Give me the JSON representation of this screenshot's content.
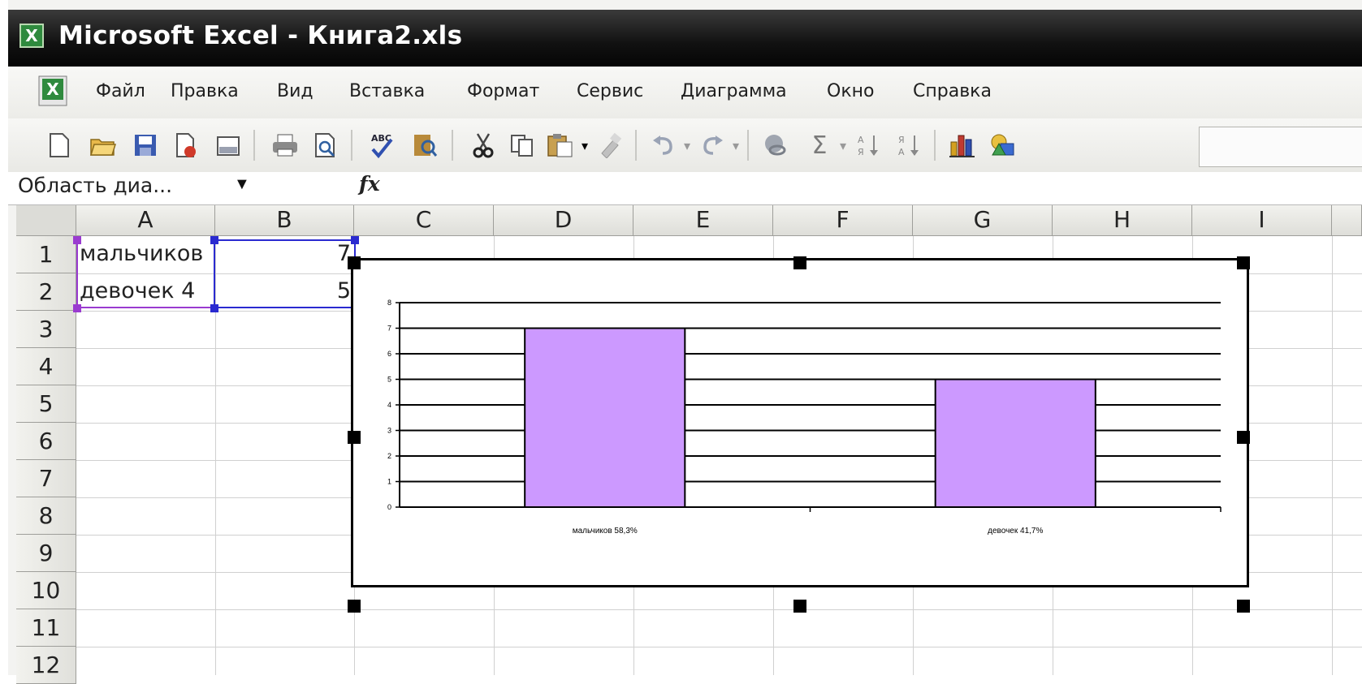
{
  "window": {
    "title": "Microsoft Excel - Книга2.xls"
  },
  "menu": {
    "items": [
      "Файл",
      "Правка",
      "Вид",
      "Вставка",
      "Формат",
      "Сервис",
      "Диаграмма",
      "Окно",
      "Справка"
    ]
  },
  "toolbar": {
    "icons": [
      "new-icon",
      "open-icon",
      "save-icon",
      "permission-icon",
      "email-icon",
      "print-icon",
      "print-preview-icon",
      "spelling-icon",
      "research-icon",
      "cut-icon",
      "copy-icon",
      "paste-icon",
      "paste-dropdown-icon",
      "format-painter-icon",
      "undo-icon",
      "undo-dropdown-icon",
      "redo-icon",
      "redo-dropdown-icon",
      "hyperlink-icon",
      "autosum-icon",
      "autosum-dropdown-icon",
      "sort-ascending-icon",
      "sort-descending-icon",
      "chart-wizard-icon",
      "drawing-icon"
    ],
    "sum_symbol": "Σ"
  },
  "formula_bar": {
    "name_box": "Область диа...",
    "fx": "fx",
    "formula": ""
  },
  "sheet": {
    "columns": [
      "A",
      "B",
      "C",
      "D",
      "E",
      "F",
      "G",
      "H",
      "I"
    ],
    "rows": [
      "1",
      "2",
      "3",
      "4",
      "5",
      "6",
      "7",
      "8",
      "9",
      "10",
      "11",
      "12"
    ],
    "cells": {
      "A1": "мальчиков",
      "B1": "7",
      "A2": "девочек 4",
      "B2": "5"
    }
  },
  "colors": {
    "bar_fill": "#cc99ff",
    "title_bar": "#111111"
  },
  "chart_data": {
    "type": "bar",
    "categories": [
      "мальчиков 58,3%",
      "девочек 41,7%"
    ],
    "series": [
      {
        "values": [
          7,
          5
        ]
      }
    ],
    "ylim": [
      0,
      8
    ],
    "yticks": [
      "0",
      "1",
      "2",
      "3",
      "4",
      "5",
      "6",
      "7",
      "8"
    ],
    "title": "",
    "xlabel": "",
    "ylabel": "",
    "grid": true,
    "legend": "none"
  }
}
